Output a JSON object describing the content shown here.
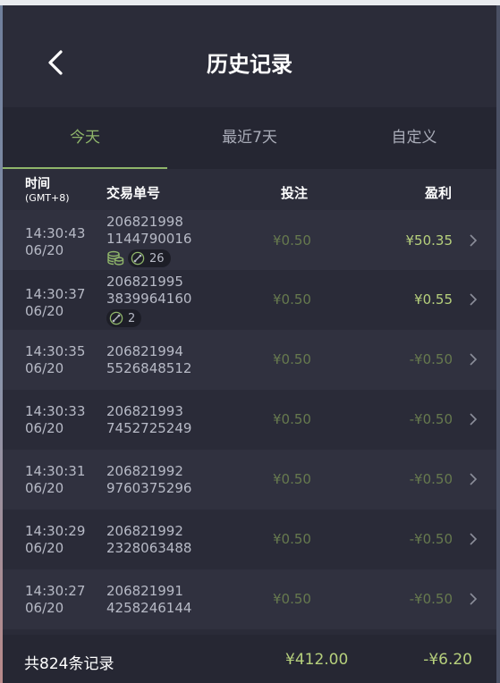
{
  "header": {
    "title": "历史记录",
    "back_icon": "chevron-left-icon"
  },
  "tabs": [
    {
      "label": "今天",
      "active": true
    },
    {
      "label": "最近7天",
      "active": false
    },
    {
      "label": "自定义",
      "active": false
    }
  ],
  "columns": {
    "time": "时间",
    "timezone": "(GMT+8)",
    "order": "交易单号",
    "bet": "投注",
    "profit": "盈利"
  },
  "rows": [
    {
      "time": "14:30:43",
      "date": "06/20",
      "order_a": "206821998",
      "order_b": "1144790016",
      "bet": "¥0.50",
      "profit": "¥50.35",
      "profit_positive": true,
      "has_coin_badge": true,
      "link_count": "26"
    },
    {
      "time": "14:30:37",
      "date": "06/20",
      "order_a": "206821995",
      "order_b": "3839964160",
      "bet": "¥0.50",
      "profit": "¥0.55",
      "profit_positive": true,
      "has_coin_badge": false,
      "link_count": "2"
    },
    {
      "time": "14:30:35",
      "date": "06/20",
      "order_a": "206821994",
      "order_b": "5526848512",
      "bet": "¥0.50",
      "profit": "-¥0.50",
      "profit_positive": false
    },
    {
      "time": "14:30:33",
      "date": "06/20",
      "order_a": "206821993",
      "order_b": "7452725249",
      "bet": "¥0.50",
      "profit": "-¥0.50",
      "profit_positive": false
    },
    {
      "time": "14:30:31",
      "date": "06/20",
      "order_a": "206821992",
      "order_b": "9760375296",
      "bet": "¥0.50",
      "profit": "-¥0.50",
      "profit_positive": false
    },
    {
      "time": "14:30:29",
      "date": "06/20",
      "order_a": "206821992",
      "order_b": "2328063488",
      "bet": "¥0.50",
      "profit": "-¥0.50",
      "profit_positive": false
    },
    {
      "time": "14:30:27",
      "date": "06/20",
      "order_a": "206821991",
      "order_b": "4258246144",
      "bet": "¥0.50",
      "profit": "-¥0.50",
      "profit_positive": false
    }
  ],
  "footer": {
    "count_label": "共824条记录",
    "total_bet": "¥412.00",
    "total_profit": "-¥6.20"
  },
  "colors": {
    "accent": "#8fb56a",
    "positive": "#b6d07c",
    "muted_green": "#66794e",
    "panel": "#2a2b38"
  }
}
